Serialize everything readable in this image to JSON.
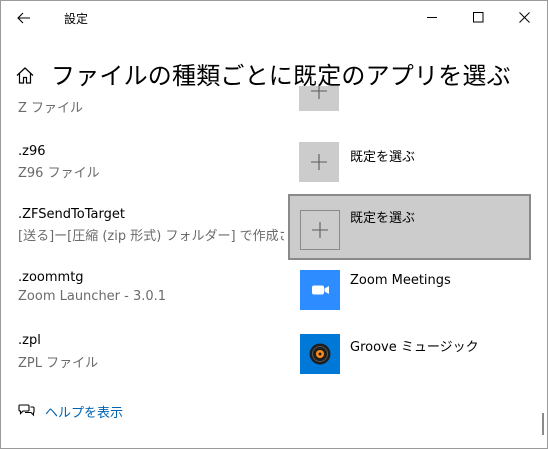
{
  "window": {
    "title": "設定"
  },
  "page": {
    "title": "ファイルの種類ごとに既定のアプリを選ぶ"
  },
  "rows": [
    {
      "ext": "",
      "desc": "Z ファイル",
      "app": ""
    },
    {
      "ext": ".z96",
      "desc": "Z96 ファイル",
      "app": "既定を選ぶ"
    },
    {
      "ext": ".ZFSendToTarget",
      "desc": "[送る]ー[圧縮 (zip 形式) フォルダー] で作成さ...",
      "app": "既定を選ぶ"
    },
    {
      "ext": ".zoommtg",
      "desc": "Zoom Launcher - 3.0.1",
      "app": "Zoom Meetings"
    },
    {
      "ext": ".zpl",
      "desc": "ZPL ファイル",
      "app": "Groove ミュージック"
    }
  ],
  "footer": {
    "help_label": "ヘルプを表示"
  },
  "colors": {
    "accent_link": "#0063b1",
    "zoom_blue": "#2d8cff",
    "groove_blue": "#0078d7",
    "tile_gray": "#cccccc"
  }
}
